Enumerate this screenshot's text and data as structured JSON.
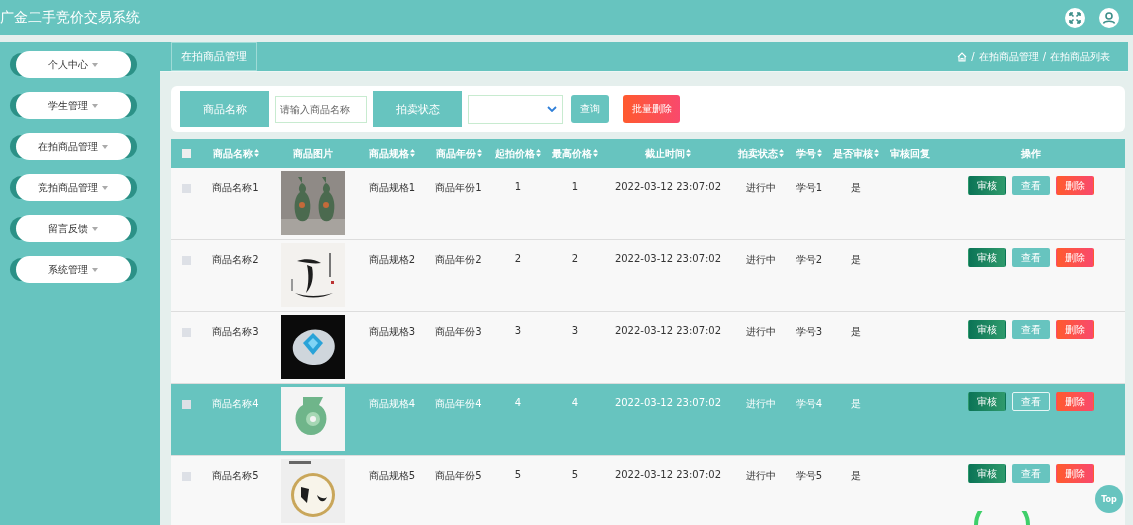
{
  "header": {
    "title": "广金二手竞价交易系统"
  },
  "sidebar": {
    "items": [
      {
        "label": "个人中心"
      },
      {
        "label": "学生管理"
      },
      {
        "label": "在拍商品管理"
      },
      {
        "label": "竞拍商品管理"
      },
      {
        "label": "留言反馈"
      },
      {
        "label": "系统管理"
      }
    ]
  },
  "page_tag": "在拍商品管理",
  "breadcrumb": {
    "separator": "/",
    "items": [
      "在拍商品管理",
      "在拍商品列表"
    ]
  },
  "search": {
    "name_label": "商品名称",
    "name_placeholder": "请输入商品名称",
    "status_label": "拍卖状态",
    "query_button": "查询",
    "batch_delete_button": "批量删除"
  },
  "table": {
    "select_all_checked": false,
    "columns": [
      {
        "label": "商品名称",
        "sortable": true
      },
      {
        "label": "商品图片",
        "sortable": false
      },
      {
        "label": "商品规格",
        "sortable": true
      },
      {
        "label": "商品年份",
        "sortable": true
      },
      {
        "label": "起拍价格",
        "sortable": true
      },
      {
        "label": "最高价格",
        "sortable": true
      },
      {
        "label": "截止时间",
        "sortable": true
      },
      {
        "label": "拍卖状态",
        "sortable": true
      },
      {
        "label": "学号",
        "sortable": true
      },
      {
        "label": "是否审核",
        "sortable": true
      },
      {
        "label": "审核回复",
        "sortable": false
      },
      {
        "label": "操作",
        "sortable": false
      }
    ],
    "rows": [
      {
        "selected": false,
        "checked": false,
        "cells": [
          "商品名称1",
          {
            "kind": "picture"
          },
          "商品规格1",
          "商品年份1",
          "1",
          "1",
          "2022-03-12 23:07:02",
          "进行中",
          "学号1",
          "是",
          ""
        ],
        "actions": [
          "审核",
          "查看",
          "删除"
        ]
      },
      {
        "selected": false,
        "checked": false,
        "cells": [
          "商品名称2",
          {
            "kind": "picture"
          },
          "商品规格2",
          "商品年份2",
          "2",
          "2",
          "2022-03-12 23:07:02",
          "进行中",
          "学号2",
          "是",
          ""
        ],
        "actions": [
          "审核",
          "查看",
          "删除"
        ]
      },
      {
        "selected": false,
        "checked": false,
        "cells": [
          "商品名称3",
          {
            "kind": "picture"
          },
          "商品规格3",
          "商品年份3",
          "3",
          "3",
          "2022-03-12 23:07:02",
          "进行中",
          "学号3",
          "是",
          ""
        ],
        "actions": [
          "审核",
          "查看",
          "删除"
        ]
      },
      {
        "selected": true,
        "checked": false,
        "cells": [
          "商品名称4",
          {
            "kind": "picture"
          },
          "商品规格4",
          "商品年份4",
          "4",
          "4",
          "2022-03-12 23:07:02",
          "进行中",
          "学号4",
          "是",
          ""
        ],
        "actions": [
          "审核",
          "查看",
          "删除"
        ]
      },
      {
        "selected": false,
        "checked": false,
        "cells": [
          "商品名称5",
          {
            "kind": "picture"
          },
          "商品规格5",
          "商品年份5",
          "5",
          "5",
          "2022-03-12 23:07:02",
          "进行中",
          "学号5",
          "是",
          ""
        ],
        "actions": [
          "审核",
          "查看",
          "删除"
        ]
      }
    ]
  },
  "top_button": "Top"
}
